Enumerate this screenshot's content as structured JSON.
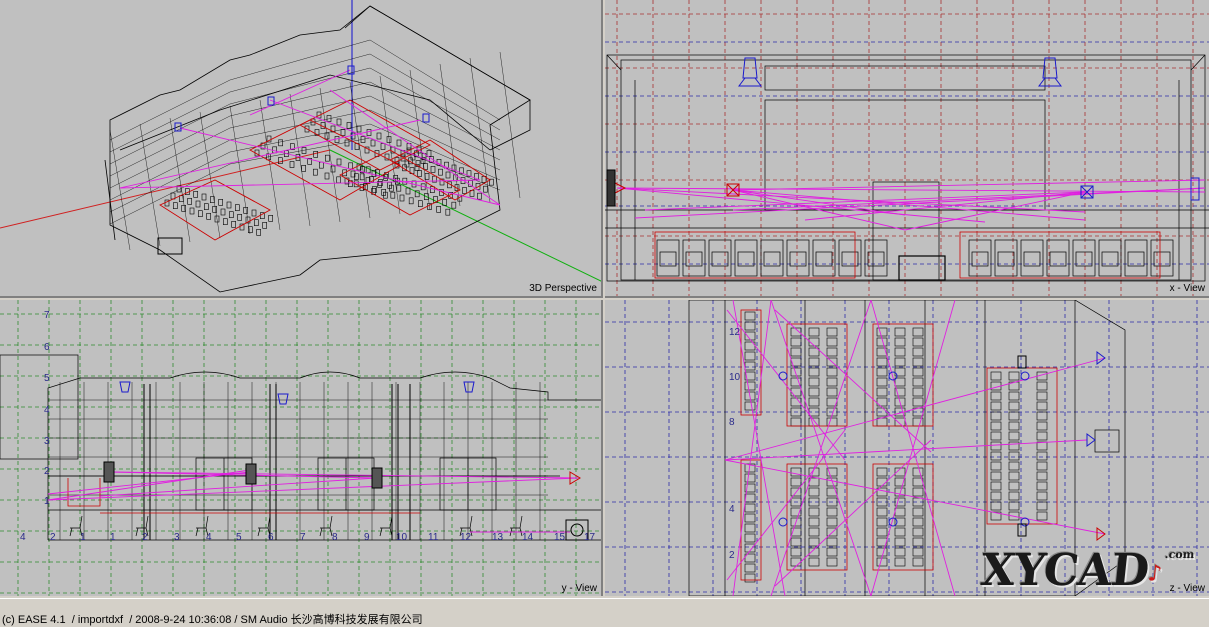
{
  "views": {
    "perspective": {
      "label": "3D Perspective"
    },
    "x": {
      "label": "x - View"
    },
    "y": {
      "label": "y - View",
      "ticks_left": [
        "7",
        "6",
        "5",
        "4",
        "3",
        "2",
        "1"
      ],
      "ticks_bottom": [
        "4",
        "2",
        "1",
        "1",
        "2",
        "3",
        "4",
        "5",
        "6",
        "7",
        "8",
        "9",
        "10",
        "11",
        "12",
        "13",
        "14",
        "15",
        "17"
      ]
    },
    "z": {
      "label": "z - View",
      "ticks_left": [
        "12",
        "10",
        "8",
        "4",
        "2"
      ]
    }
  },
  "status": {
    "copyright": "(c) EASE 4.1",
    "project": "/ importdxf",
    "timestamp": "/ 2008-9-24 10:36:08",
    "company": "/ SM Audio 长沙高博科技发展有限公司"
  },
  "watermark": {
    "brand": "XYCAD",
    "suffix": ".com"
  },
  "colors": {
    "background": "#c0c0c0",
    "wireframe": "#000000",
    "grid_green": "#2e8b2e",
    "grid_blue": "#2a2aa8",
    "grid_red": "#a83030",
    "ray_magenta": "#e020e0",
    "speaker_blue": "#1a1acc",
    "boundary_red": "#cc0000"
  }
}
